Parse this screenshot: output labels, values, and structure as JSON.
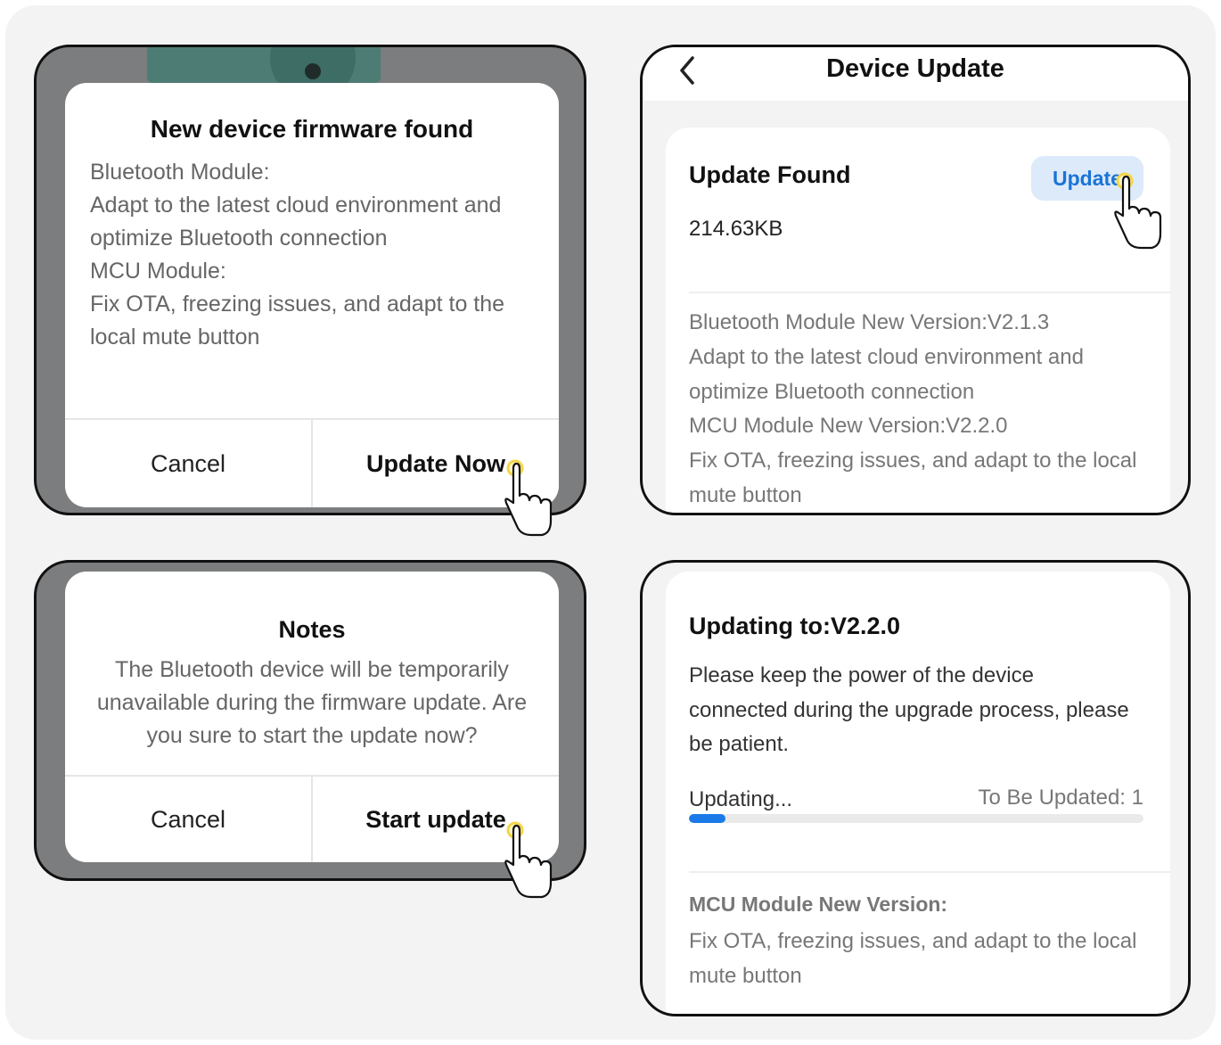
{
  "firmware_dialog": {
    "title": "New device firmware found",
    "lines": [
      "Bluetooth Module:",
      "Adapt to the latest cloud environment and",
      "optimize Bluetooth connection",
      "MCU Module:",
      "Fix OTA, freezing issues, and adapt to the",
      "local mute button"
    ],
    "cancel_label": "Cancel",
    "confirm_label": "Update Now"
  },
  "device_update": {
    "nav_title": "Device Update",
    "back_icon": "chevron-left-icon",
    "card_title": "Update Found",
    "size": "214.63KB",
    "update_button": "Update",
    "notes": [
      "Bluetooth Module New Version:V2.1.3",
      "Adapt to the latest cloud environment and",
      "optimize Bluetooth connection",
      "MCU Module New Version:V2.2.0",
      "Fix OTA, freezing issues, and adapt to the local",
      "mute button"
    ]
  },
  "notes_dialog": {
    "title": "Notes",
    "body": "The Bluetooth device will be temporarily unavailable during the firmware update. Are you sure to start the update now?",
    "cancel_label": "Cancel",
    "confirm_label": "Start update"
  },
  "updating": {
    "title": "Updating to:V2.2.0",
    "description": "Please keep the power of the device connected during the upgrade process, please be patient.",
    "status": "Updating...",
    "remaining": "To Be Updated: 1",
    "progress": 0.08,
    "mcu_title": "MCU Module New Version:",
    "mcu_lines": [
      "Fix OTA, freezing issues, and adapt to the local",
      "mute button"
    ]
  },
  "colors": {
    "accent": "#1c7ae8",
    "update_button_bg": "#ddeafa",
    "dialog_overlay": "#7c7d7e",
    "tap_highlight": "#f5d547"
  },
  "icons": [
    "hand-pointer-icon",
    "chevron-left-icon"
  ]
}
